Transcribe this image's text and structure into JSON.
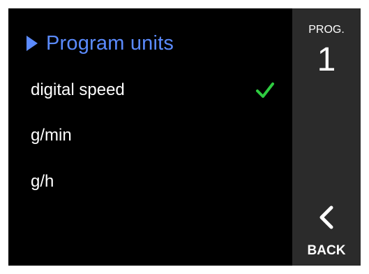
{
  "menu": {
    "title": "Program units",
    "title_icon": "triangle-right-icon",
    "options": [
      {
        "label": "digital speed",
        "selected": true
      },
      {
        "label": "g/min",
        "selected": false
      },
      {
        "label": "g/h",
        "selected": false
      }
    ],
    "selected_icon": "check-icon"
  },
  "side": {
    "prog_label": "PROG.",
    "prog_number": "1",
    "back_label": "BACK",
    "back_icon": "chevron-left-icon"
  },
  "colors": {
    "accent": "#5b8bff",
    "check": "#2ecc40",
    "background": "#000000",
    "side_panel": "#2b2b2b",
    "text": "#ffffff"
  }
}
